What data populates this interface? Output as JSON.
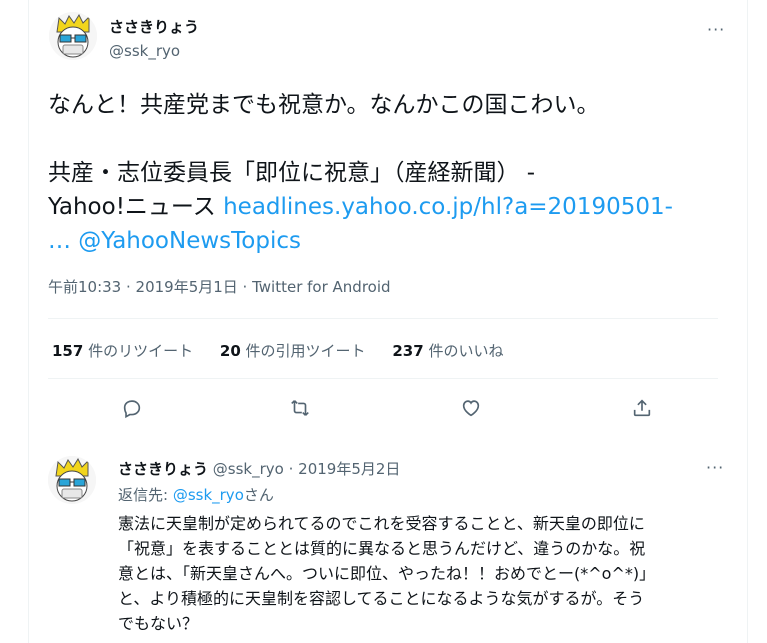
{
  "main_tweet": {
    "author_name": "ささきりょう",
    "author_handle": "@ssk_ryo",
    "more_label": "···",
    "line1": "なんと！共産党までも祝意か。なんかこの国こわい。",
    "line2": "共産・志位委員長「即位に祝意」（産経新聞） -",
    "line3_text": "Yahoo!ニュース ",
    "line3_link": "headlines.yahoo.co.jp/hl?a=20190501-",
    "line4_link": "… @YahooNewsTopics",
    "timestamp": "午前10:33 · 2019年5月1日 · Twitter for Android",
    "retweets_count": "157",
    "retweets_label": "件のリツイート",
    "quotes_count": "20",
    "quotes_label": "件の引用ツイート",
    "likes_count": "237",
    "likes_label": "件のいいね",
    "actions": {
      "reply": "reply-icon",
      "retweet": "retweet-icon",
      "like": "heart-icon",
      "share": "share-icon"
    }
  },
  "reply_tweet": {
    "author_name": "ささきりょう",
    "author_handle": "@ssk_ryo",
    "date": "· 2019年5月2日",
    "more_label": "···",
    "replying_prefix": "返信先: ",
    "replying_handle": "@ssk_ryo",
    "replying_suffix": "さん",
    "lines": [
      "憲法に天皇制が定められてるのでこれを受容することと、新天皇の即位に",
      "「祝意」を表することとは質的に異なると思うんだけど、違うのかな。祝",
      "意とは、「新天皇さんへ。ついに即位、やったね！！おめでとー(*^o^*)」",
      "と、より積極的に天皇制を容認してることになるような気がするが。そう",
      "でもない？"
    ]
  },
  "colors": {
    "link": "#1d9bf0",
    "secondary": "#536471",
    "text": "#0f1419"
  }
}
